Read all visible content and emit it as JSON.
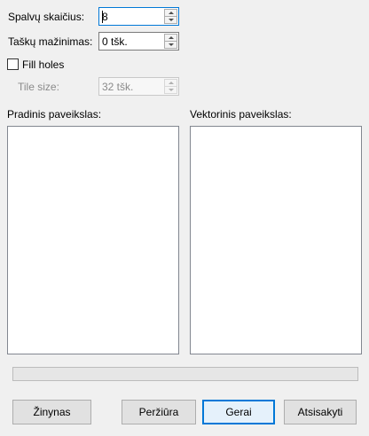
{
  "form": {
    "colors": {
      "label": "Spalvų skaičius:",
      "value": "8"
    },
    "point_reduction": {
      "label": "Taškų mažinimas:",
      "value": "0 tšk."
    },
    "fill_holes": {
      "label": "Fill holes",
      "checked": false
    },
    "tile_size": {
      "label": "Tile size:",
      "value": "32 tšk.",
      "enabled": false
    }
  },
  "previews": {
    "source_label": "Pradinis paveikslas:",
    "vector_label": "Vektorinis paveikslas:"
  },
  "progress": {
    "value": 0
  },
  "buttons": {
    "help": "Žinynas",
    "preview": "Peržiūra",
    "ok": "Gerai",
    "cancel": "Atsisakyti"
  }
}
